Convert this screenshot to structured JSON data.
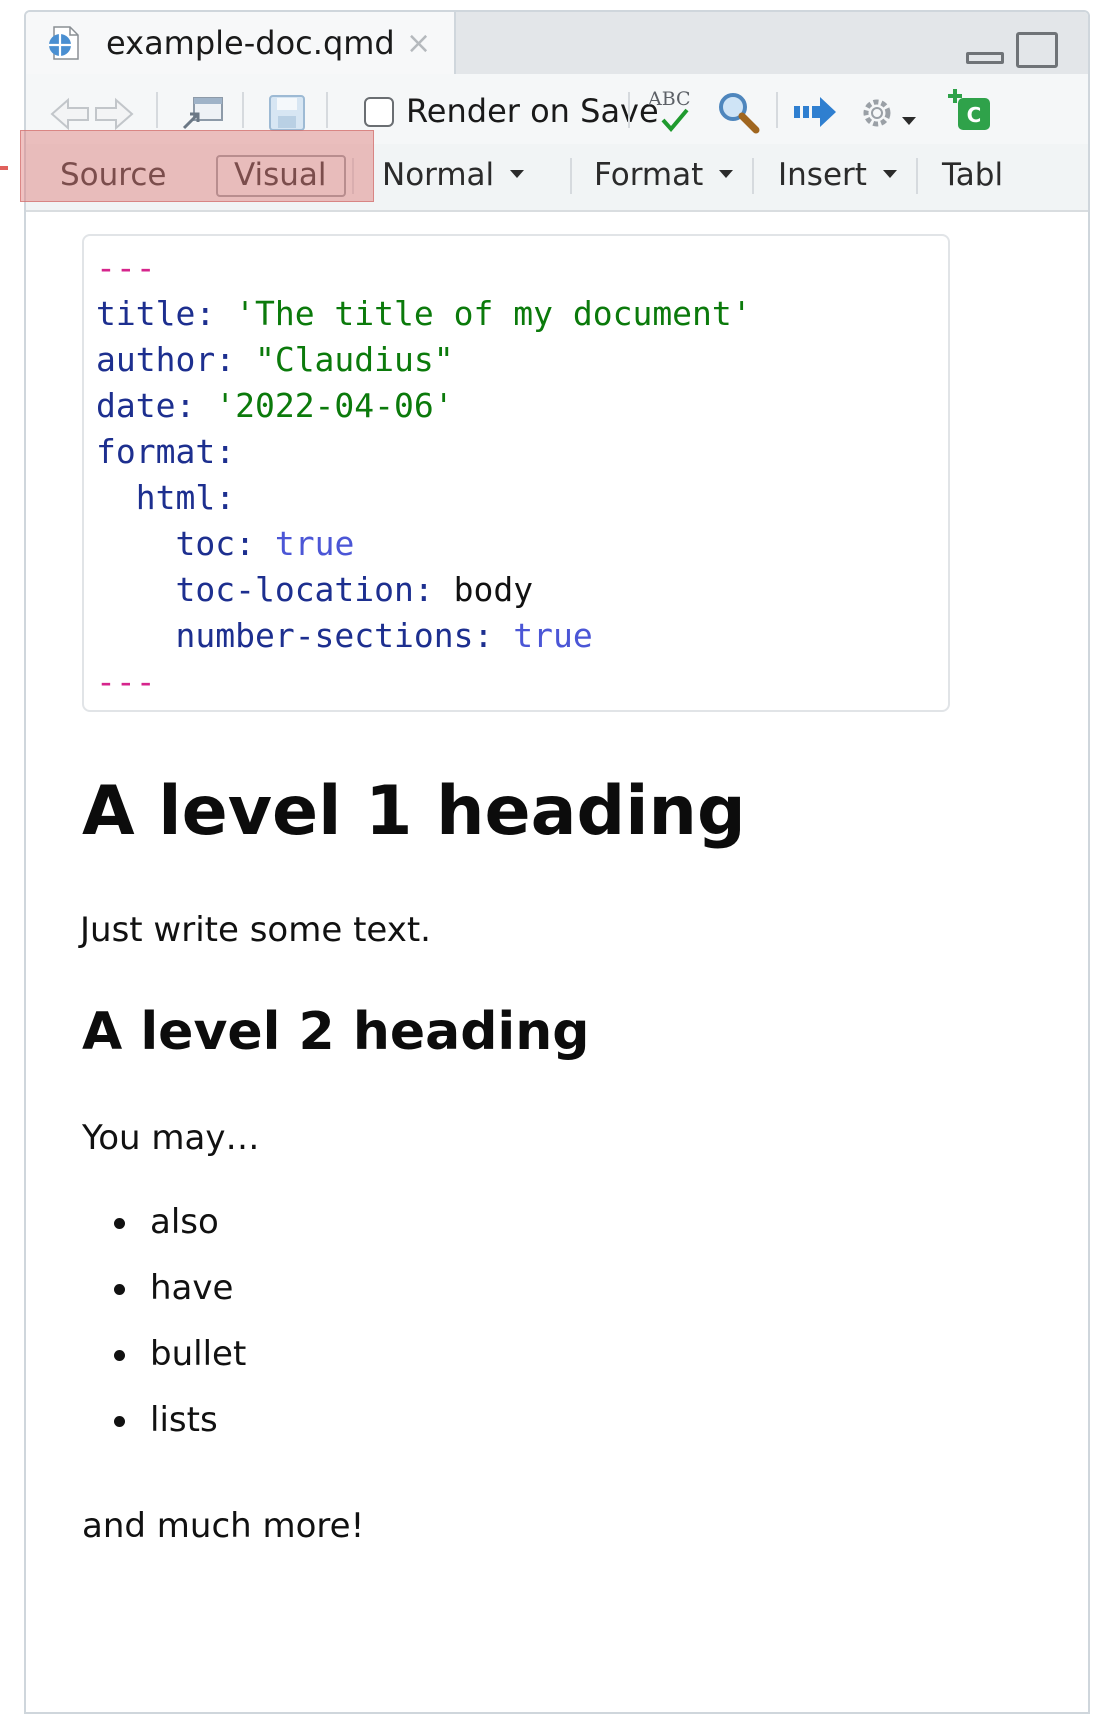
{
  "tab": {
    "title": "example-doc.qmd",
    "close": "×"
  },
  "toolbar": {
    "render_on_save_label": "Render on Save",
    "render_on_save_checked": false,
    "spellcheck_label": "ABC",
    "icons": [
      "back-arrow-icon",
      "forward-arrow-icon",
      "show-in-window-icon",
      "save-icon",
      "spellcheck-icon",
      "find-icon",
      "render-icon",
      "settings-gear-icon",
      "insert-code-chunk-icon"
    ]
  },
  "visual_toolbar": {
    "source_label": "Source",
    "visual_label": "Visual",
    "style_label": "Normal",
    "format_label": "Format",
    "insert_label": "Insert",
    "table_label": "Tabl"
  },
  "yaml": {
    "open": "---",
    "title_key": "title:",
    "title_val": "'The title of my document'",
    "author_key": "author:",
    "author_val": "\"Claudius\"",
    "date_key": "date:",
    "date_val": "'2022-04-06'",
    "format_key": "format:",
    "html_key": "html:",
    "toc_key": "toc:",
    "toc_val": "true",
    "toc_location_key": "toc-location:",
    "toc_location_val": "body",
    "number_sections_key": "number-sections:",
    "number_sections_val": "true",
    "close": "---"
  },
  "content": {
    "h1": "A level 1 heading",
    "p1": "Just write some text.",
    "h2": "A level 2 heading",
    "p2": "You may…",
    "bullets": [
      "also",
      "have",
      "bullet",
      "lists"
    ],
    "p3": "and much more!"
  },
  "colors": {
    "highlight": "#de7876",
    "yaml_key": "#1d2f8f",
    "yaml_string": "#0b7a0b",
    "yaml_bool": "#4b56d6",
    "yaml_delimiter": "#d6258c"
  }
}
